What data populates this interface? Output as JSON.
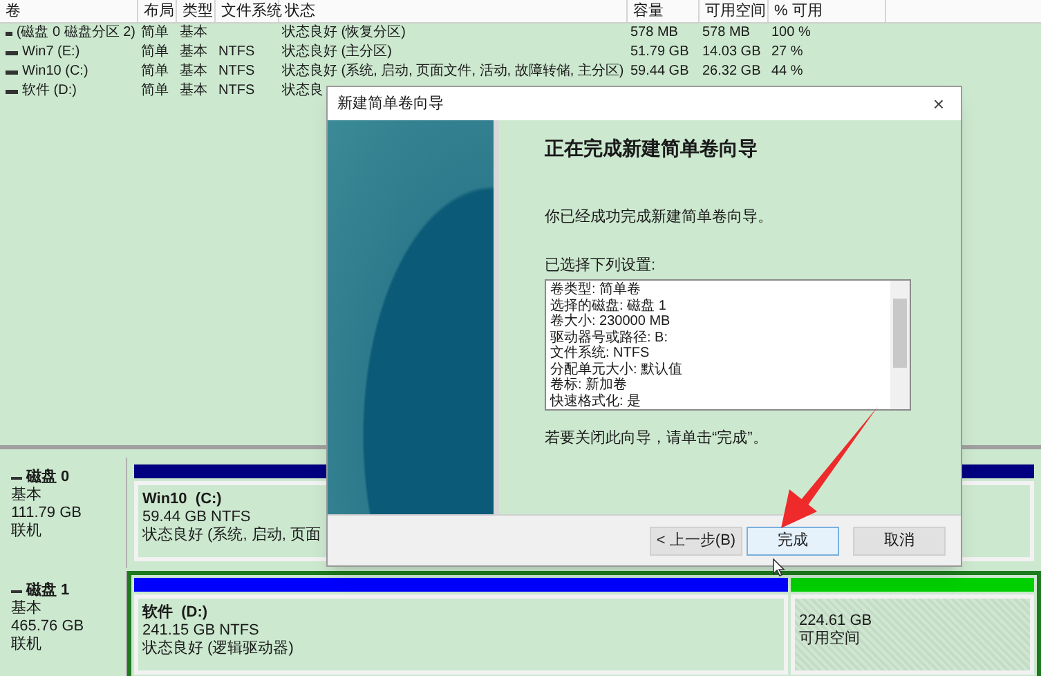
{
  "volume_table": {
    "columns": [
      "卷",
      "布局",
      "类型",
      "文件系统",
      "状态",
      "容量",
      "可用空间",
      "% 可用"
    ],
    "rows": [
      {
        "volume": "(磁盘 0 磁盘分区 2)",
        "layout": "简单",
        "type": "基本",
        "status": "状态良好 (恢复分区)",
        "capacity": "578 MB",
        "free": "578 MB",
        "percent": "100 %"
      },
      {
        "volume": "Win7 (E:)",
        "layout": "简单",
        "type": "基本",
        "file_system": "NTFS",
        "status": "状态良好 (主分区)",
        "capacity": "51.79 GB",
        "free": "14.03 GB",
        "percent": "27 %"
      },
      {
        "volume": "Win10 (C:)",
        "layout": "简单",
        "type": "基本",
        "file_system": "NTFS",
        "status": "状态良好 (系统, 启动, 页面文件, 活动, 故障转储, 主分区)",
        "capacity": "59.44 GB",
        "free": "26.32 GB",
        "percent": "44 %"
      },
      {
        "volume": "软件 (D:)",
        "layout": "简单",
        "type": "基本",
        "file_system": "NTFS",
        "status": "状态良"
      }
    ]
  },
  "disks": [
    {
      "name": "磁盘 0",
      "type": "基本",
      "size": "111.79 GB",
      "status": "联机",
      "selected": false,
      "partitions": [
        {
          "kind": "primary",
          "name": "Win10  (C:)",
          "size": "59.44 GB NTFS",
          "status": "状态良好 (系统, 启动, 页面"
        }
      ]
    },
    {
      "name": "磁盘 1",
      "type": "基本",
      "size": "465.76 GB",
      "status": "联机",
      "selected": true,
      "partitions": [
        {
          "kind": "logical",
          "name": "软件  (D:)",
          "size": "241.15 GB NTFS",
          "status": "状态良好 (逻辑驱动器)"
        },
        {
          "kind": "free",
          "size": "224.61 GB",
          "status": "可用空间"
        }
      ]
    }
  ],
  "wizard": {
    "title": "新建简单卷向导",
    "close": "×",
    "heading": "正在完成新建简单卷向导",
    "message": "你已经成功完成新建简单卷向导。",
    "settings_label": "已选择下列设置:",
    "settings": [
      "卷类型: 简单卷",
      "选择的磁盘: 磁盘 1",
      "卷大小: 230000 MB",
      "驱动器号或路径: B:",
      "文件系统: NTFS",
      "分配单元大小: 默认值",
      "卷标: 新加卷",
      "快速格式化: 是"
    ],
    "hint": "若要关闭此向导，请单击“完成”。",
    "buttons": [
      {
        "label": "< 上一步(B)",
        "default": false
      },
      {
        "label": "完成",
        "default": true
      },
      {
        "label": "取消",
        "default": false
      }
    ]
  }
}
